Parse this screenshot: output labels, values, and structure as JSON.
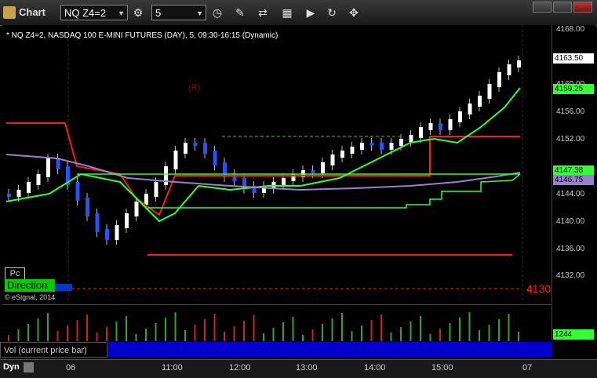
{
  "titlebar": {
    "title": "Chart",
    "symbol_value": "NQ Z4=2",
    "interval_value": "5",
    "icons": [
      "chart-icon",
      "symbol-dropdown-icon",
      "gear-icon",
      "interval-dropdown-icon",
      "clock-icon",
      "pencil-icon",
      "swap-icon",
      "calc-icon",
      "play-icon",
      "refresh-icon",
      "cursor-icon"
    ]
  },
  "chart_info": "* NQ Z4=2, NASDAQ 100 E-MINI FUTURES (DAY), 5, 09:30-16:15 (Dynamic)",
  "price_axis": {
    "labels": [
      "4168.00",
      "4164.00",
      "4160.00",
      "4156.00",
      "4152.00",
      "4148.00",
      "4144.00",
      "4140.00",
      "4136.00",
      "4132.00"
    ],
    "current_price": "4163.50",
    "green_level": "4159.25",
    "level_2": "4147.38",
    "level_3": "4146.75"
  },
  "markers": {
    "r_marker": "(R)",
    "level_label": "4130"
  },
  "pane_buttons": {
    "pc": "Pc",
    "direction": "Direction",
    "copyright": "© eSignal, 2014"
  },
  "volume": {
    "label": "Vol (current price bar)",
    "value": "1244"
  },
  "time_axis": {
    "dyn": "Dyn",
    "labels": [
      "06",
      "11:00",
      "12:00",
      "13:00",
      "14:00",
      "15:00",
      "07"
    ]
  },
  "seq_counts": {
    "green_left": [
      "2",
      "3",
      "4",
      "5",
      "6",
      "7",
      "8",
      "9",
      "1",
      "2",
      "3",
      "4",
      "5",
      "6",
      "7",
      "8",
      "9"
    ],
    "right_green": [
      "1",
      "2",
      "3",
      "4",
      "5",
      "6",
      "7",
      "8",
      "9"
    ],
    "right_magenta": [
      "1",
      "2",
      "3",
      "4",
      "5"
    ]
  },
  "colors": {
    "up_bar": "#ffffff",
    "down_bar": "#2255ff",
    "red_line": "#ff1a1a",
    "green_line": "#33ff33",
    "purple_line": "#9a7fd0",
    "magenta": "#ff33ff",
    "seq_green": "#2e9f2e"
  }
}
